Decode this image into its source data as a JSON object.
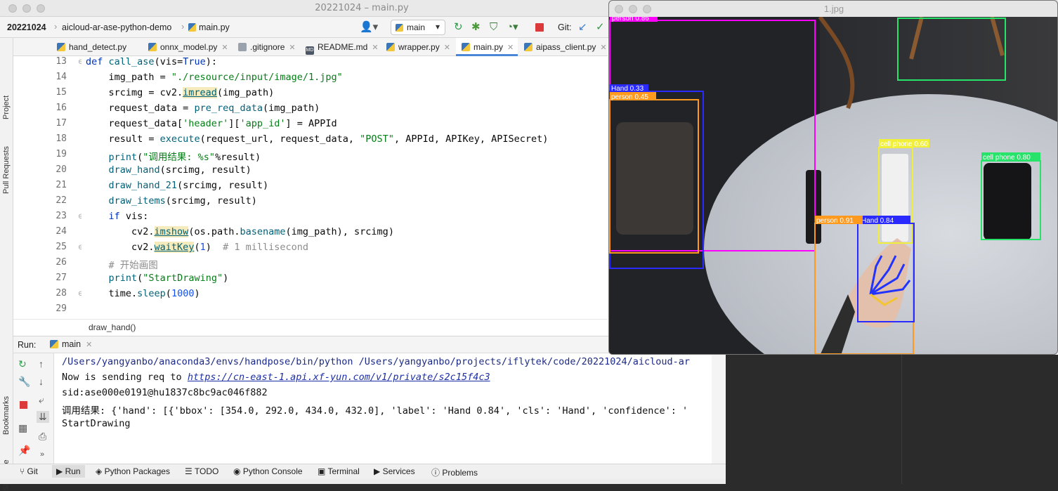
{
  "window": {
    "title": "20221024 – main.py"
  },
  "breadcrumb": {
    "project": "20221024",
    "folder": "aicloud-ar-ase-python-demo",
    "file": "main.py"
  },
  "toolbar": {
    "branch": "main",
    "git_label": "Git:"
  },
  "left_strip": {
    "project": "Project",
    "pull_requests": "Pull Requests",
    "bookmarks": "Bookmarks",
    "structure": "Structure"
  },
  "tabs": [
    {
      "label": "hand_detect.py",
      "active": false
    },
    {
      "label": "onnx_model.py",
      "active": false
    },
    {
      "label": ".gitignore",
      "active": false
    },
    {
      "label": "README.md",
      "active": false
    },
    {
      "label": "wrapper.py",
      "active": false
    },
    {
      "label": "main.py",
      "active": true
    },
    {
      "label": "aipass_client.py",
      "active": false
    }
  ],
  "editor": {
    "line_numbers": [
      "13",
      "14",
      "15",
      "16",
      "17",
      "18",
      "19",
      "20",
      "21",
      "22",
      "23",
      "24",
      "25",
      "26",
      "27",
      "28",
      "29"
    ],
    "lines": [
      "def call_ase(vis=True):",
      "    img_path = \"./resource/input/image/1.jpg\"",
      "    srcimg = cv2.imread(img_path)",
      "    request_data = pre_req_data(img_path)",
      "    request_data['header']['app_id'] = APPId",
      "    result = execute(request_url, request_data, \"POST\", APPId, APIKey, APISecret)",
      "    print(\"调用结果: %s\"%result)",
      "    draw_hand(srcimg, result)",
      "    draw_hand_21(srcimg, result)",
      "    draw_items(srcimg, result)",
      "    if vis:",
      "        cv2.imshow(os.path.basename(img_path), srcimg)",
      "        cv2.waitKey(1)  # 1 millisecond",
      "    # 开始画图",
      "    print(\"StartDrawing\")",
      "    time.sleep(1000)",
      ""
    ],
    "breadcrumb_fn": "draw_hand()"
  },
  "run": {
    "label": "Run:",
    "config": "main",
    "output": [
      "/Users/yangyanbo/anaconda3/envs/handpose/bin/python /Users/yangyanbo/projects/iflytek/code/20221024/aicloud-ar",
      "Now is sending req to ",
      "sid:ase000e0191@hu1837c8bc9ac046f882",
      "调用结果: {'hand': [{'bbox': [354.0, 292.0, 434.0, 432.0], 'label': 'Hand 0.84', 'cls': 'Hand', 'confidence': '",
      "StartDrawing"
    ],
    "link": "https://cn-east-1.api.xf-yun.com/v1/private/s2c15f4c3"
  },
  "bottom_tools": [
    "Git",
    "Run",
    "Python Packages",
    "TODO",
    "Python Console",
    "Terminal",
    "Services",
    "Problems"
  ],
  "image_window": {
    "title": "1.jpg",
    "labels": [
      "person 0.86",
      "Hand 0.33",
      "person 0.45",
      "cell phone 0.60",
      "cell phone 0.80",
      "person 0.91",
      "Hand 0.84"
    ]
  },
  "colors": {
    "accent": "#4a86d6",
    "keyword": "#0033b3",
    "function": "#00627a",
    "string": "#067d17",
    "number": "#1750eb",
    "comment": "#8c8c8c",
    "box_magenta": "#ff00ff",
    "box_blue": "#2a2aff",
    "box_orange": "#ff9a1e",
    "box_yellow": "#f0f03a",
    "box_green": "#27e36a"
  }
}
